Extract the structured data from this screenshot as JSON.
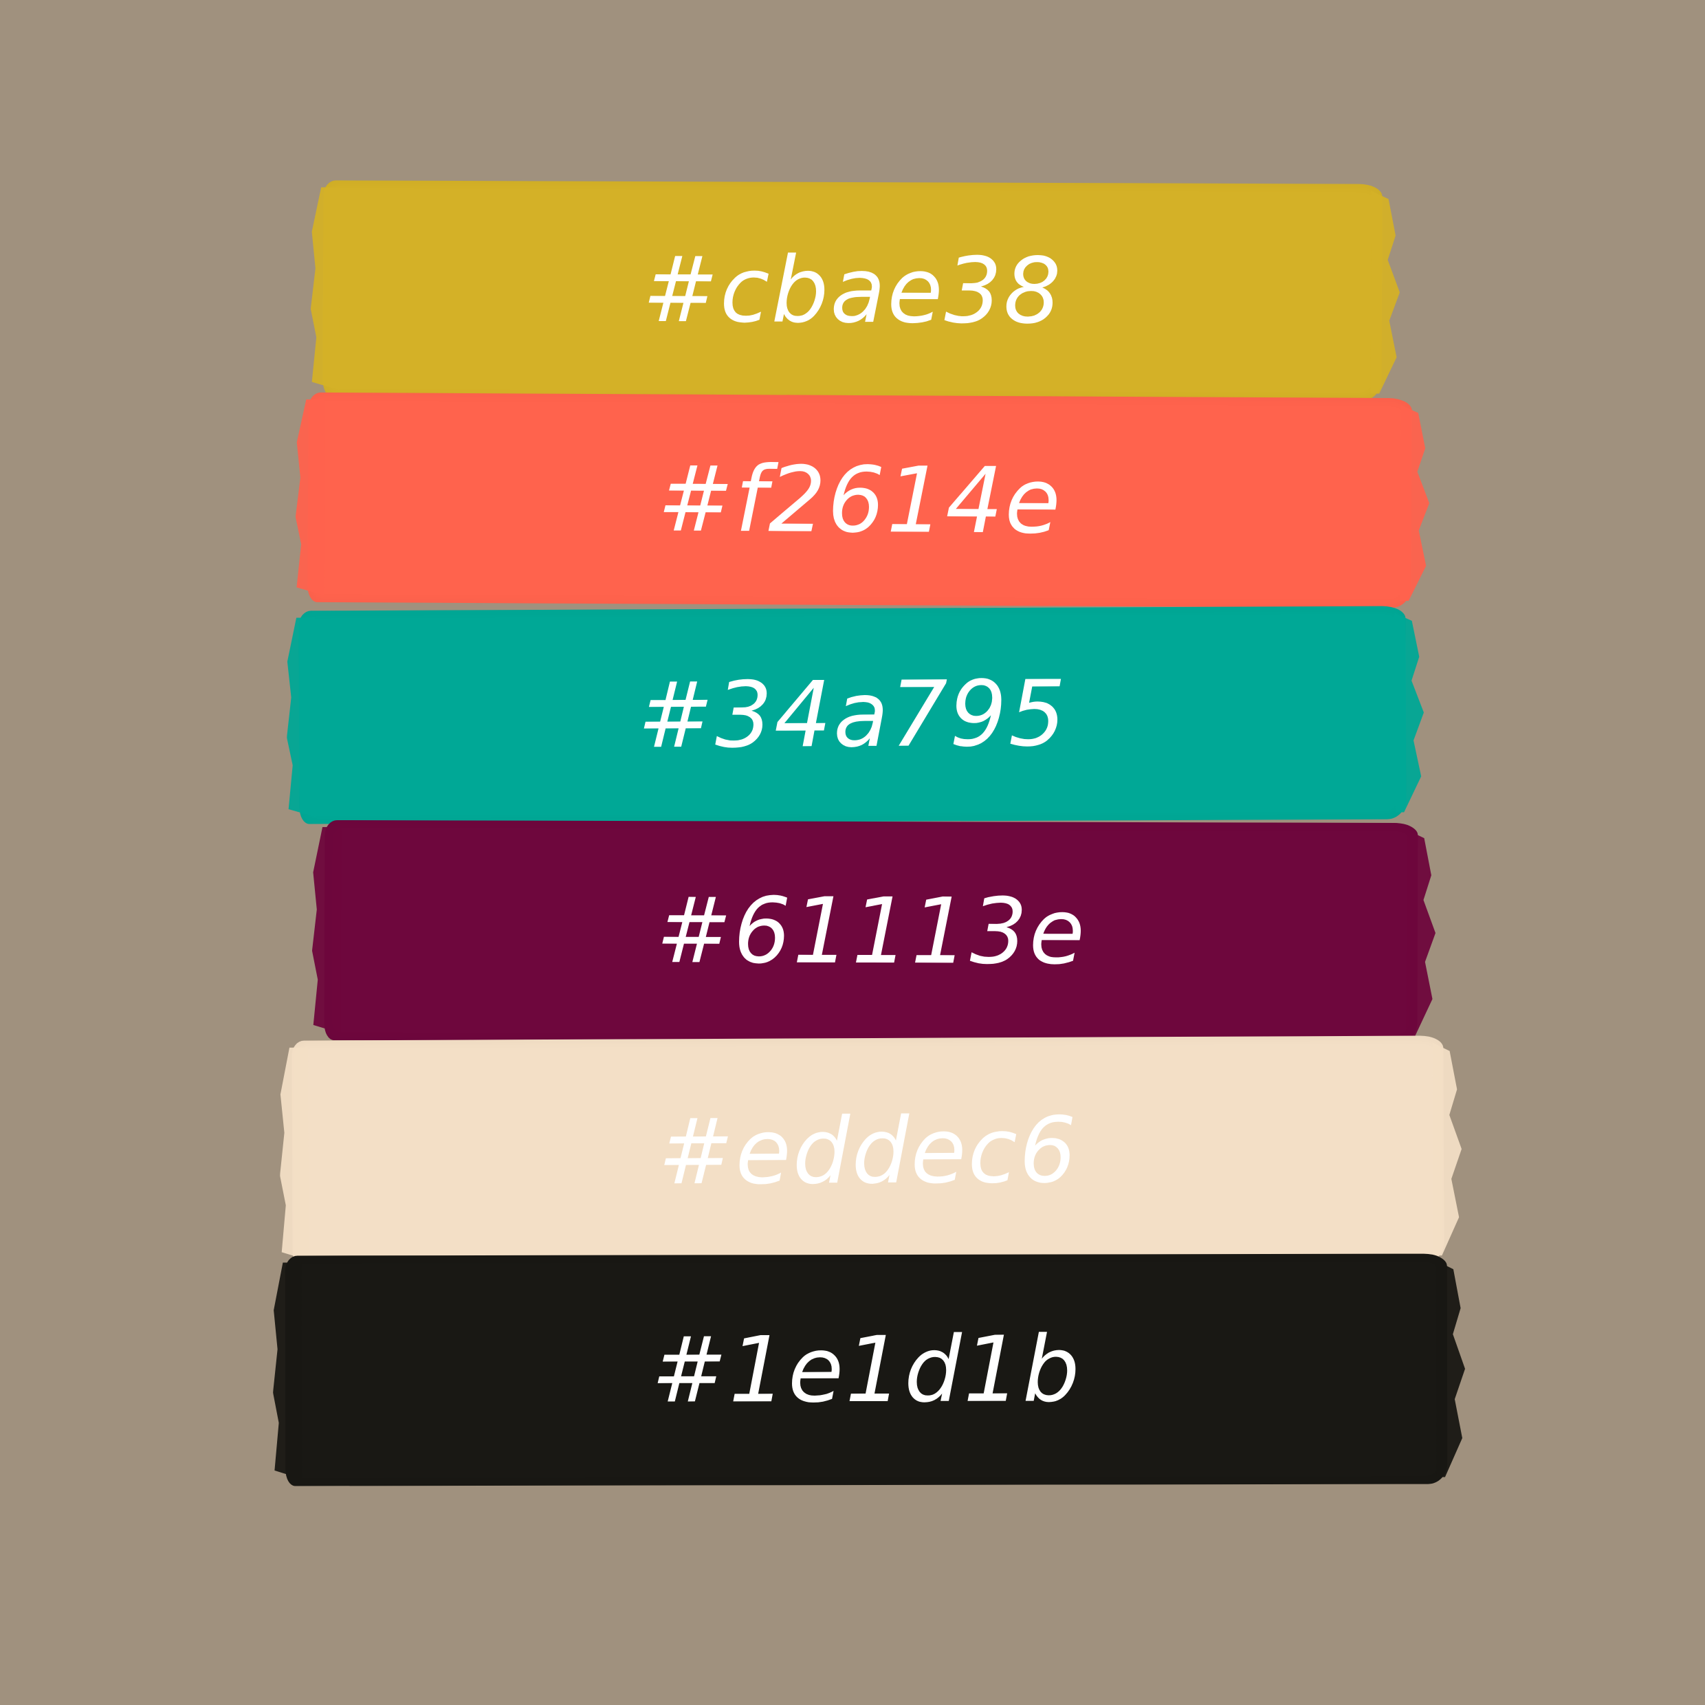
{
  "background_color": "#a0917e",
  "swatches": [
    {
      "label": "#cbae38",
      "color": "#d4b127"
    },
    {
      "label": "#f2614e",
      "color": "#ff634d"
    },
    {
      "label": "#34a795",
      "color": "#00a896"
    },
    {
      "label": "#61113e",
      "color": "#6e073d"
    },
    {
      "label": "#eddec6",
      "color": "#f3dfc6"
    },
    {
      "label": "#1e1d1b",
      "color": "#191814"
    }
  ]
}
